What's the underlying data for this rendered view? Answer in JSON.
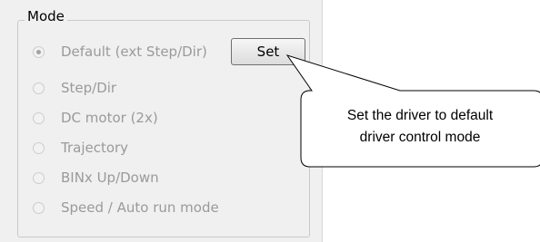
{
  "group": {
    "title": "Mode"
  },
  "radios": [
    {
      "label": "Default (ext Step/Dir)",
      "selected": true
    },
    {
      "label": "Step/Dir",
      "selected": false
    },
    {
      "label": "DC motor (2x)",
      "selected": false
    },
    {
      "label": "Trajectory",
      "selected": false
    },
    {
      "label": "BINx Up/Down",
      "selected": false
    },
    {
      "label": "Speed / Auto run mode",
      "selected": false
    }
  ],
  "set_button": {
    "label": "Set"
  },
  "callout": {
    "line1": "Set the driver to default",
    "line2": "driver control mode"
  }
}
